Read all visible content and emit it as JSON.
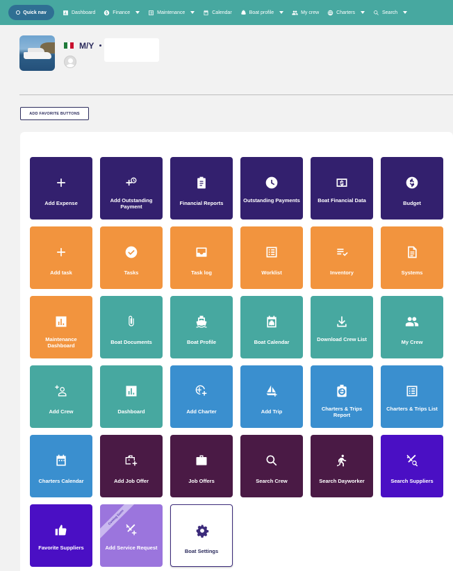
{
  "nav": {
    "quick": "Quick nav",
    "items": [
      {
        "label": "Dashboard",
        "icon": "dashboard-icon",
        "caret": false
      },
      {
        "label": "Finance",
        "icon": "dollar-icon",
        "caret": true
      },
      {
        "label": "Maintenance",
        "icon": "list-icon",
        "caret": true
      },
      {
        "label": "Calendar",
        "icon": "calendar-icon",
        "caret": false
      },
      {
        "label": "Boat profile",
        "icon": "boat-icon",
        "caret": true
      },
      {
        "label": "My crew",
        "icon": "people-icon",
        "caret": false
      },
      {
        "label": "Charters",
        "icon": "globe-icon",
        "caret": true
      },
      {
        "label": "Search",
        "icon": "search-icon",
        "caret": true
      }
    ]
  },
  "header": {
    "boat_title": "M/Y"
  },
  "actions": {
    "add_favorite": "ADD FAVORITE BUTTONS"
  },
  "colors": {
    "purple_dark": "#33206e",
    "orange": "#f2943e",
    "teal": "#47a8a0",
    "blue": "#3a8fcf",
    "plum": "#4a1a45",
    "violet": "#4a0fc4",
    "lavender": "#9b75dd"
  },
  "tiles": [
    {
      "label": "Add Expense",
      "icon": "plus-icon",
      "color": "#33206e"
    },
    {
      "label": "Add Outstanding Payment",
      "icon": "plus-clock-icon",
      "color": "#33206e"
    },
    {
      "label": "Financial Reports",
      "icon": "clipboard-icon",
      "color": "#33206e"
    },
    {
      "label": "Outstanding Payments",
      "icon": "clock-icon",
      "color": "#33206e"
    },
    {
      "label": "Boat Financial Data",
      "icon": "money-icon",
      "color": "#33206e"
    },
    {
      "label": "Budget",
      "icon": "dollar-circle-icon",
      "color": "#33206e"
    },
    {
      "label": "Add task",
      "icon": "plus-icon",
      "color": "#f2943e"
    },
    {
      "label": "Tasks",
      "icon": "check-circle-icon",
      "color": "#f2943e"
    },
    {
      "label": "Task log",
      "icon": "inbox-icon",
      "color": "#f2943e"
    },
    {
      "label": "Worklist",
      "icon": "list-box-icon",
      "color": "#f2943e"
    },
    {
      "label": "Inventory",
      "icon": "checklist-icon",
      "color": "#f2943e"
    },
    {
      "label": "Systems",
      "icon": "document-icon",
      "color": "#f2943e"
    },
    {
      "label": "Maintenance Dashboard",
      "icon": "bar-chart-icon",
      "color": "#f2943e"
    },
    {
      "label": "Boat Documents",
      "icon": "paperclip-icon",
      "color": "#47a8a0"
    },
    {
      "label": "Boat Profile",
      "icon": "ship-icon",
      "color": "#47a8a0"
    },
    {
      "label": "Boat Calendar",
      "icon": "calendar-boat-icon",
      "color": "#47a8a0"
    },
    {
      "label": "Download Crew List",
      "icon": "download-icon",
      "color": "#47a8a0"
    },
    {
      "label": "My Crew",
      "icon": "people-icon",
      "color": "#47a8a0"
    },
    {
      "label": "Add Crew",
      "icon": "add-person-icon",
      "color": "#47a8a0"
    },
    {
      "label": "Dashboard",
      "icon": "bar-chart-icon",
      "color": "#47a8a0"
    },
    {
      "label": "Add Charter",
      "icon": "globe-plus-icon",
      "color": "#3a8fcf"
    },
    {
      "label": "Add Trip",
      "icon": "sail-plus-icon",
      "color": "#3a8fcf"
    },
    {
      "label": "Charters & Trips Report",
      "icon": "globe-badge-icon",
      "color": "#3a8fcf"
    },
    {
      "label": "Charters & Trips List",
      "icon": "list-box-icon",
      "color": "#3a8fcf"
    },
    {
      "label": "Charters Calendar",
      "icon": "calendar-icon",
      "color": "#3a8fcf"
    },
    {
      "label": "Add Job Offer",
      "icon": "briefcase-plus-icon",
      "color": "#4a1a45"
    },
    {
      "label": "Job Offers",
      "icon": "briefcase-icon",
      "color": "#4a1a45"
    },
    {
      "label": "Search Crew",
      "icon": "search-icon",
      "color": "#4a1a45"
    },
    {
      "label": "Search Dayworker",
      "icon": "runner-icon",
      "color": "#4a1a45"
    },
    {
      "label": "Search Suppliers",
      "icon": "tools-search-icon",
      "color": "#4a0fc4"
    },
    {
      "label": "Favorite Suppliers",
      "icon": "thumbs-up-icon",
      "color": "#4a0fc4"
    },
    {
      "label": "Add Service Request",
      "icon": "tools-plus-icon",
      "color": "#9b75dd",
      "ribbon": "Coming Soon"
    },
    {
      "label": "Boat Settings",
      "icon": "gear-icon",
      "color": "#ffffff",
      "outlined": true
    }
  ]
}
